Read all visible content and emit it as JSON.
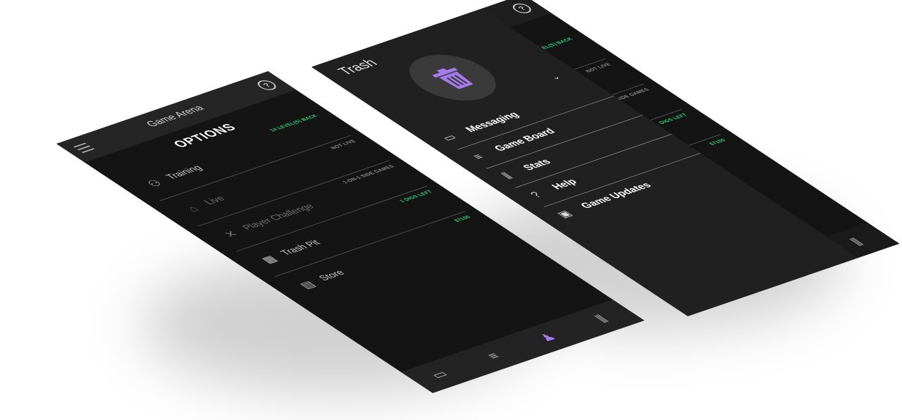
{
  "colors": {
    "accent": "#a77bef",
    "positive": "#2fd17a",
    "background": "#141414",
    "bar": "#252525"
  },
  "left_phone": {
    "app_title": "Game Arena",
    "help_icon": "?",
    "section_title": "OPTIONS",
    "options": [
      {
        "label": "Training",
        "meta": "14 LEVEL(S) BACK",
        "icon": "training-icon",
        "glyph": "⚇"
      },
      {
        "label": "Live",
        "meta": "NOT LIVE",
        "icon": "live-icon",
        "glyph": "⌂"
      },
      {
        "label": "Player Challenge",
        "meta": "1-ON-1 SIDE GAMES",
        "icon": "crossed-swords-icon",
        "glyph": "✕"
      },
      {
        "label": "Trash Pit",
        "meta": "1 DIGS LEFT",
        "icon": "trash-pit-icon",
        "glyph": "▦"
      },
      {
        "label": "Store",
        "meta": "$7100",
        "icon": "store-icon",
        "glyph": "▤"
      }
    ],
    "bottom_nav": [
      {
        "icon": "messaging-icon",
        "glyph": "▭"
      },
      {
        "icon": "game-board-icon",
        "glyph": "≡"
      },
      {
        "icon": "player-icon",
        "glyph": "♟"
      },
      {
        "icon": "stats-icon",
        "glyph": "⫼"
      }
    ]
  },
  "right_phone": {
    "help_icon": "?",
    "drawer_title": "Trash",
    "chevron": "⌄",
    "background_options": [
      {
        "meta": "LEVEL(S) BACK"
      },
      {
        "meta": "NOT LIVE"
      },
      {
        "meta": "SIDE GAMES"
      },
      {
        "meta": "DIGS LEFT"
      },
      {
        "meta": "$7100"
      }
    ],
    "menu": [
      {
        "label": "Messaging",
        "icon": "messaging-icon",
        "glyph": "▭"
      },
      {
        "label": "Game Board",
        "icon": "game-board-icon",
        "glyph": "≡"
      },
      {
        "label": "Stats",
        "icon": "stats-icon",
        "glyph": "⫼"
      },
      {
        "label": "Help",
        "icon": "help-icon",
        "glyph": "?"
      },
      {
        "label": "Game Updates",
        "icon": "clipboard-icon",
        "glyph": "▣"
      }
    ],
    "bottom_icon": {
      "icon": "stats-icon",
      "glyph": "⫼"
    }
  }
}
